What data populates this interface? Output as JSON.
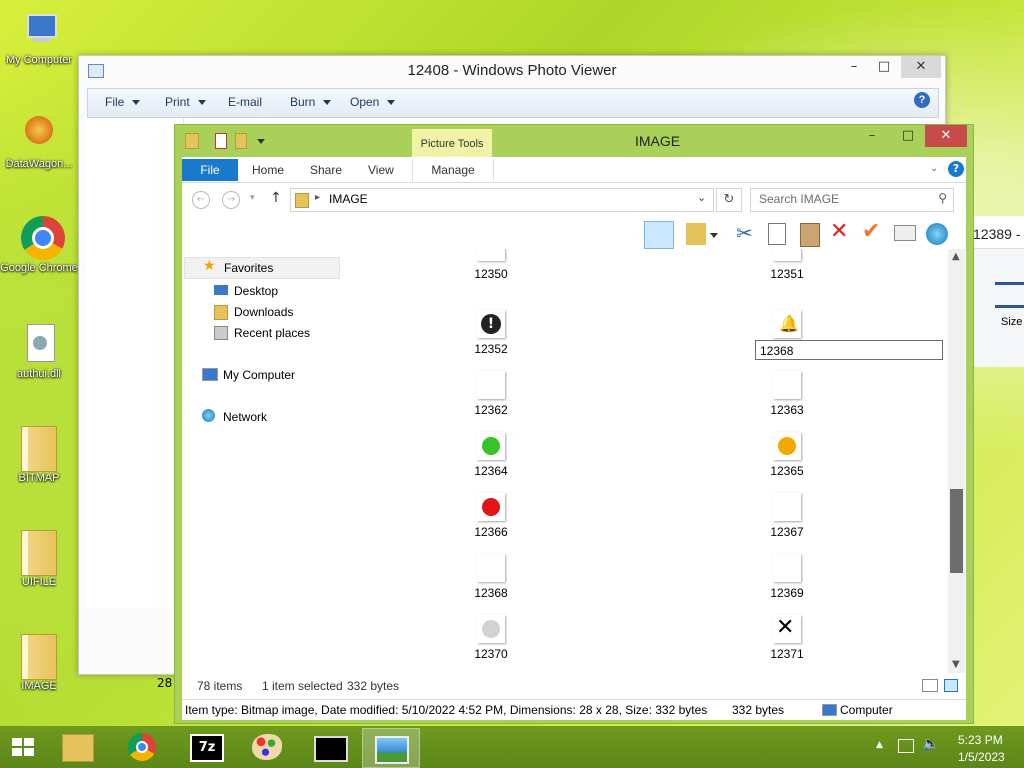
{
  "desktop": {
    "icons": [
      {
        "label": "My Computer"
      },
      {
        "label": "DataWagon..."
      },
      {
        "label": "Google Chrome"
      },
      {
        "label": "authui.dll"
      },
      {
        "label": "BITMAP"
      },
      {
        "label": "UIFILE"
      },
      {
        "label": "IMAGE"
      }
    ],
    "side_text": "28",
    "behind_window": {
      "title": "12389 -",
      "size_label": "Size"
    }
  },
  "photo_viewer": {
    "title": "12408 - Windows Photo Viewer",
    "menu": [
      "File",
      "Print",
      "E-mail",
      "Burn",
      "Open"
    ]
  },
  "explorer": {
    "title": "IMAGE",
    "context_tab_group": "Picture Tools",
    "tabs": [
      "File",
      "Home",
      "Share",
      "View",
      "Manage"
    ],
    "address": "IMAGE",
    "search_placeholder": "Search IMAGE",
    "nav": {
      "favorites": "Favorites",
      "favorites_items": [
        "Desktop",
        "Downloads",
        "Recent places"
      ],
      "computer": "My Computer",
      "network": "Network"
    },
    "files": [
      {
        "name": "12350",
        "icon": "blank"
      },
      {
        "name": "12351",
        "icon": "blank"
      },
      {
        "name": "12352",
        "icon": "exclamation"
      },
      {
        "name": "12368",
        "icon": "bell",
        "renaming": true
      },
      {
        "name": "12362",
        "icon": "blank"
      },
      {
        "name": "12363",
        "icon": "blank"
      },
      {
        "name": "12364",
        "icon": "green-dot"
      },
      {
        "name": "12365",
        "icon": "orange-dot"
      },
      {
        "name": "12366",
        "icon": "red-dot"
      },
      {
        "name": "12367",
        "icon": "blank"
      },
      {
        "name": "12368",
        "icon": "blank"
      },
      {
        "name": "12369",
        "icon": "blank"
      },
      {
        "name": "12370",
        "icon": "grey-dot"
      },
      {
        "name": "12371",
        "icon": "x-mark"
      }
    ],
    "status": {
      "items": "78 items",
      "selected": "1 item selected",
      "size": "332 bytes"
    },
    "details": {
      "text": "Item type: Bitmap image, Date modified: 5/10/2022 4:52 PM, Dimensions: 28 x 28, Size: 332 bytes",
      "size": "332 bytes",
      "location": "Computer"
    }
  },
  "taskbar": {
    "time": "5:23 PM",
    "date": "1/5/2023"
  },
  "colors": {
    "explorer_frame": "#a9d159",
    "taskbar": "#5f8a1a",
    "selection": "#cce8ff"
  }
}
